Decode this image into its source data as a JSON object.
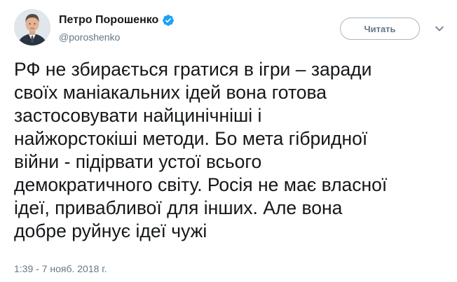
{
  "author": {
    "name": "Петро Порошенко",
    "handle": "@poroshenko",
    "verified": true
  },
  "follow_button": {
    "label": "Читать"
  },
  "tweet": {
    "lines": [
      "РФ не збирається гратися в ігри – заради",
      "своїх маніакальних ідей вона готова",
      "застосовувати найцинічніші і",
      "найжорстокіші методи. Бо мета гібридної",
      "війни - підірвати устої всього",
      "демократичного світу. Росія не має власної",
      "ідеї, привабливої для інших. Але вона",
      "добре руйнує ідеї чужі"
    ],
    "timestamp": "1:39 - 7 нояб. 2018 г."
  },
  "icons": {
    "verified": "verified-badge-icon",
    "caret": "chevron-down-icon",
    "avatar": "avatar"
  },
  "colors": {
    "text": "#14171a",
    "secondary": "#657786",
    "verified": "#1da1f2",
    "button_border": "#a8b6c1"
  }
}
